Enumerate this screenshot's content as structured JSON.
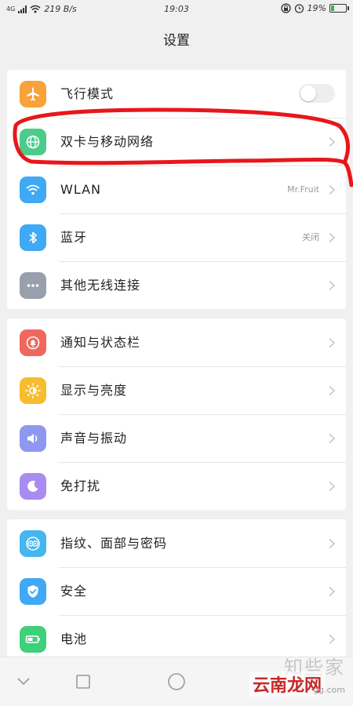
{
  "status_bar": {
    "network_type": "4G",
    "speed": "219 B/s",
    "time": "19:03",
    "battery": "19%",
    "battery_level": 0.19,
    "icons": [
      "signal-icon",
      "wifi-icon",
      "lock-rotation-icon",
      "alarm-icon",
      "battery-icon"
    ]
  },
  "header": {
    "title": "设置"
  },
  "groups": [
    {
      "items": [
        {
          "label": "飞行模式",
          "icon": "airplane-icon",
          "color": "#f7a23b",
          "control": "toggle",
          "toggle_on": false
        },
        {
          "label": "双卡与移动网络",
          "icon": "globe-icon",
          "color": "#4ccb8a",
          "control": "chevron"
        },
        {
          "label": "WLAN",
          "icon": "wifi-icon",
          "color": "#3fa9f5",
          "control": "chevron",
          "value": "Mr.Fruit"
        },
        {
          "label": "蓝牙",
          "icon": "bluetooth-icon",
          "color": "#3fa9f5",
          "control": "chevron",
          "value": "关闭"
        },
        {
          "label": "其他无线连接",
          "icon": "more-dots-icon",
          "color": "#9a9fae",
          "control": "chevron"
        }
      ]
    },
    {
      "items": [
        {
          "label": "通知与状态栏",
          "icon": "notification-bell-icon",
          "color": "#f0675e",
          "control": "chevron"
        },
        {
          "label": "显示与亮度",
          "icon": "brightness-icon",
          "color": "#f6bd2f",
          "control": "chevron"
        },
        {
          "label": "声音与振动",
          "icon": "speaker-icon",
          "color": "#8e98f0",
          "control": "chevron"
        },
        {
          "label": "免打扰",
          "icon": "moon-icon",
          "color": "#a98cf0",
          "control": "chevron"
        }
      ]
    },
    {
      "items": [
        {
          "label": "指纹、面部与密码",
          "icon": "fingerprint-icon",
          "color": "#45b6f0",
          "control": "chevron"
        },
        {
          "label": "安全",
          "icon": "shield-check-icon",
          "color": "#3fa9f5",
          "control": "chevron"
        },
        {
          "label": "电池",
          "icon": "battery-icon",
          "color": "#3ed07a",
          "control": "chevron"
        }
      ]
    }
  ],
  "annotation": {
    "color": "#e8161b",
    "target": "双卡与移动网络"
  },
  "nav_bar": {
    "icons": [
      "back-chevron-icon",
      "recents-square-icon",
      "home-circle-icon"
    ]
  },
  "watermark": {
    "top_text": "知些家",
    "main_text": "云南龙网",
    "url": "gg.com"
  }
}
